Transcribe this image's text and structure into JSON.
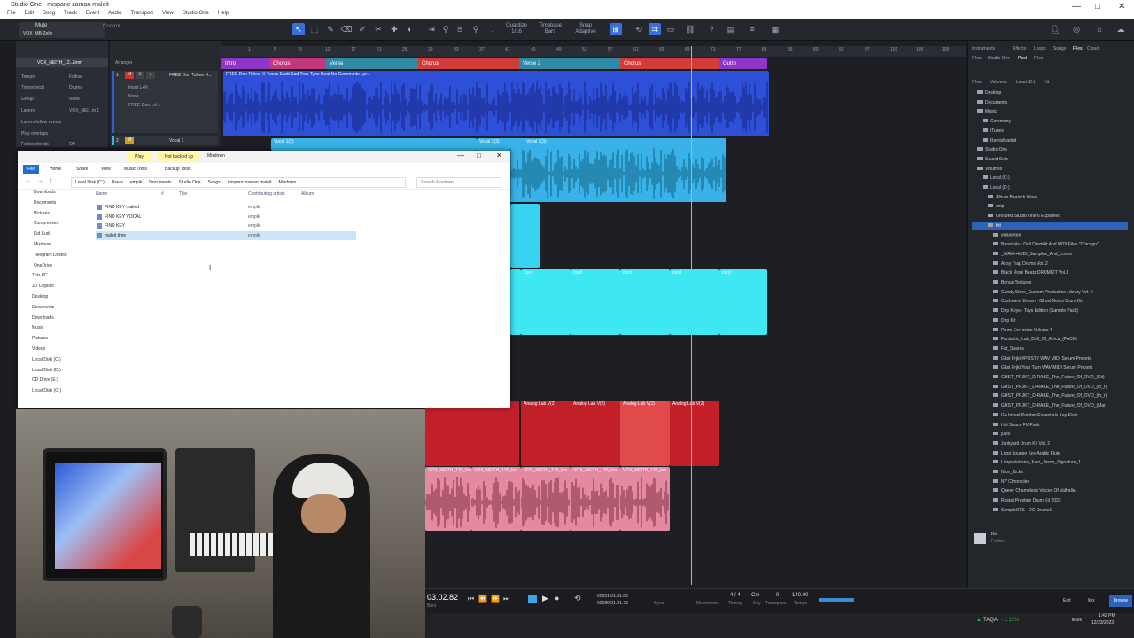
{
  "window": {
    "title": "Studio One - mispanc zaman maleit",
    "menu": [
      "File",
      "Edit",
      "Song",
      "Track",
      "Event",
      "Audio",
      "Transport",
      "View",
      "Studio One",
      "Help"
    ],
    "controls": [
      "—",
      "□",
      "✕"
    ]
  },
  "toolbar": {
    "mute_label": "Mute",
    "channel_name": "VOX_MB-Zelin",
    "control_label": "Control",
    "quantize": {
      "label": "Quantize",
      "value": "1/16"
    },
    "timebase": {
      "label": "Timebase",
      "value": "Bars"
    },
    "snap": {
      "label": "Snap",
      "value": "Adaptive"
    }
  },
  "inspector": {
    "track_name": "VOX_NEITH_12..Zmm",
    "rows": [
      {
        "k": "Tempo",
        "v": "Follow"
      },
      {
        "k": "Timestretch",
        "v": "Drums"
      },
      {
        "k": "Group",
        "v": "None"
      },
      {
        "k": "Layers",
        "v": "VOX_NEI...m 1"
      },
      {
        "k": "Layers follow events",
        "v": ""
      },
      {
        "k": "Play overlaps",
        "v": ""
      },
      {
        "k": "Follow chords",
        "v": "Off"
      }
    ]
  },
  "arranger_label": "Arranger",
  "tracks": [
    {
      "num": "1",
      "name": "FREE Don Toliver X...",
      "io1": "Input L+R",
      "io2": "None",
      "io3": "FREE Don...el 1"
    },
    {
      "num": "2",
      "name": "Vocal 1",
      "io1": "",
      "io2": "",
      "io3": ""
    }
  ],
  "ruler": [
    "1",
    "5",
    "9",
    "13",
    "17",
    "21",
    "25",
    "29",
    "33",
    "37",
    "41",
    "45",
    "49",
    "53",
    "57",
    "61",
    "65",
    "69",
    "73",
    "77",
    "81",
    "85",
    "89",
    "93",
    "97",
    "101",
    "105",
    "109",
    "113",
    "117"
  ],
  "sections": [
    {
      "name": "Intro",
      "color": "#8d36c9"
    },
    {
      "name": "Chorus",
      "color": "#c2377d"
    },
    {
      "name": "Verse",
      "color": "#2f8aa6"
    },
    {
      "name": "Chorus",
      "color": "#d33b3b"
    },
    {
      "name": "Verse 2",
      "color": "#2f8aa6"
    },
    {
      "name": "Chorus",
      "color": "#d33b3b"
    },
    {
      "name": "Outro",
      "color": "#8d36c9"
    }
  ],
  "clips": {
    "beat_label": "FREE Don Toliver X Travis Scott Sad Trap Type Beat No Comments Lyr...",
    "vocal_labels": [
      "Vocal 1(2)",
      "Vocal 1(2)",
      "Vocal 1(3)"
    ],
    "cord_label": "cord",
    "analog_label": "Analog Lab V(2)",
    "vox_label": "VOX_NEITH_120_bm"
  },
  "browser": {
    "tabs": [
      "Instruments",
      "Effects",
      "Loops",
      "Songs",
      "Files",
      "Cloud"
    ],
    "subtabs": [
      "Files",
      "Studio One",
      "Pool",
      "Files"
    ],
    "path": [
      "Files",
      "Volumes",
      "Local (D:)",
      "Kit"
    ],
    "tree": [
      "Desktop",
      "Documents",
      "Music",
      "Ceremony",
      "iTunes",
      "RemixMadeit",
      "Studio One",
      "Sound Sets",
      "Volumes",
      "Local (C:)",
      "Local (D:)",
      "Album Beatsck Wave",
      "enip",
      "Grooved Studio One 6 Explained",
      "Kit",
      "########",
      "Beaxtz4a - Drill Drumkit And MIDI Files \"Chicago\"",
      "_WAVe+MIDI_Samples_And_Loops",
      "Artsy Trap Drums Vol. 2",
      "Black Rose Beatz DRUMKIT Vol.1",
      "Bonus Textures",
      "Candy Store_Custom Production Library Vol. II",
      "Cashmere Brown - Ghost Notes Drum Kit",
      "Drip Keys - Toys Edition (Sample Pack)",
      "Drip Kit",
      "Drum Excursion Volume 1",
      "Fantastic_Lab_Drill_Of_Africa_(PACK)",
      "Fat_Snares",
      "Ghst Prjkt #POSTY WAV MIDI Serum Presets",
      "Ghst Prjkt Your Turn WAV MIDI Serum Presets",
      "GHST_PRJKT_D-RAKE_The_Future_Of_OVO_(Kit)",
      "GHST_PRJKT_D-RAKE_The_Future_Of_OVO_(ln_r)",
      "GHST_PRJKT_D-RAKE_The_Future_Of_OVO_(ln_r)",
      "GHST_PRJKT_D-RAKE_The_Future_Of_OVO_(Mar",
      "Go Imtsel Pandan Essentials Key Flute",
      "Hot Sauce FX Pack",
      "jules",
      "Junkyard Drum Kit Vol. 2",
      "Loop Lounge Key Arabic Flute",
      "Loopsolutions_Juez_Jason_Signature_1",
      "Nice_Kicks",
      "NY Chronicles",
      "Queen Chameleon Voices Of Valhalla",
      "Ruspo Prestige Drum Kit 2022",
      "SampleSTS - DC Drums1"
    ],
    "footer_folder": "Kit",
    "footer_sub": "Folder"
  },
  "transport": {
    "position": "03.02.82",
    "position_sub": "Bars",
    "time1": "00001.01.01.00",
    "time2": "00089.01.01.73",
    "sync": "Sync",
    "metronome": "Metronome",
    "timing_label": "Timing",
    "signature": "4 / 4",
    "key": "Cm",
    "key_label": "Key",
    "transpose": "0",
    "transpose_label": "Transpose",
    "tempo": "140.00",
    "tempo_label": "Tempo",
    "edit": "Edit",
    "mix": "Mix",
    "browse": "Browse"
  },
  "taskbar": {
    "ticker": "TAQA",
    "change": "+1.13%",
    "lang": "ENG",
    "time": "1:42 PM",
    "date": "12/23/2023"
  },
  "explorer": {
    "tabs": [
      "File",
      "Home",
      "Share",
      "View",
      "Music Tools",
      "Backup Tools"
    ],
    "title_left": "Play",
    "title_mid": "Not backed up",
    "title_right": "Mixdown",
    "address": [
      "Local Disk (C:)",
      "Users",
      "empik",
      "Documents",
      "Studio One",
      "Songs",
      "mispanc zaman maleit",
      "Mixdown"
    ],
    "search_placeholder": "Search Mixdown",
    "columns": [
      "Name",
      "#",
      "Title",
      "Contributing artists",
      "Album"
    ],
    "files": [
      {
        "name": "FIND KEY maleid",
        "artist": "empik"
      },
      {
        "name": "FIND KEY VOCAL",
        "artist": "empik"
      },
      {
        "name": "FIND KEY",
        "artist": "empik"
      },
      {
        "name": "maleit time",
        "artist": "empik"
      }
    ],
    "nav": [
      "Downloads",
      "Documents",
      "Pictures",
      "Compressed",
      "Kid Kudi",
      "Mixdown",
      "Telegram Deskto",
      "OneDrive",
      "This PC",
      "3D Objects",
      "Desktop",
      "Documents",
      "Downloads",
      "Music",
      "Pictures",
      "Videos",
      "Local Disk (C:)",
      "Local Disk (D:)",
      "CD Drive (E:)",
      "Local Disk (G:)"
    ]
  }
}
